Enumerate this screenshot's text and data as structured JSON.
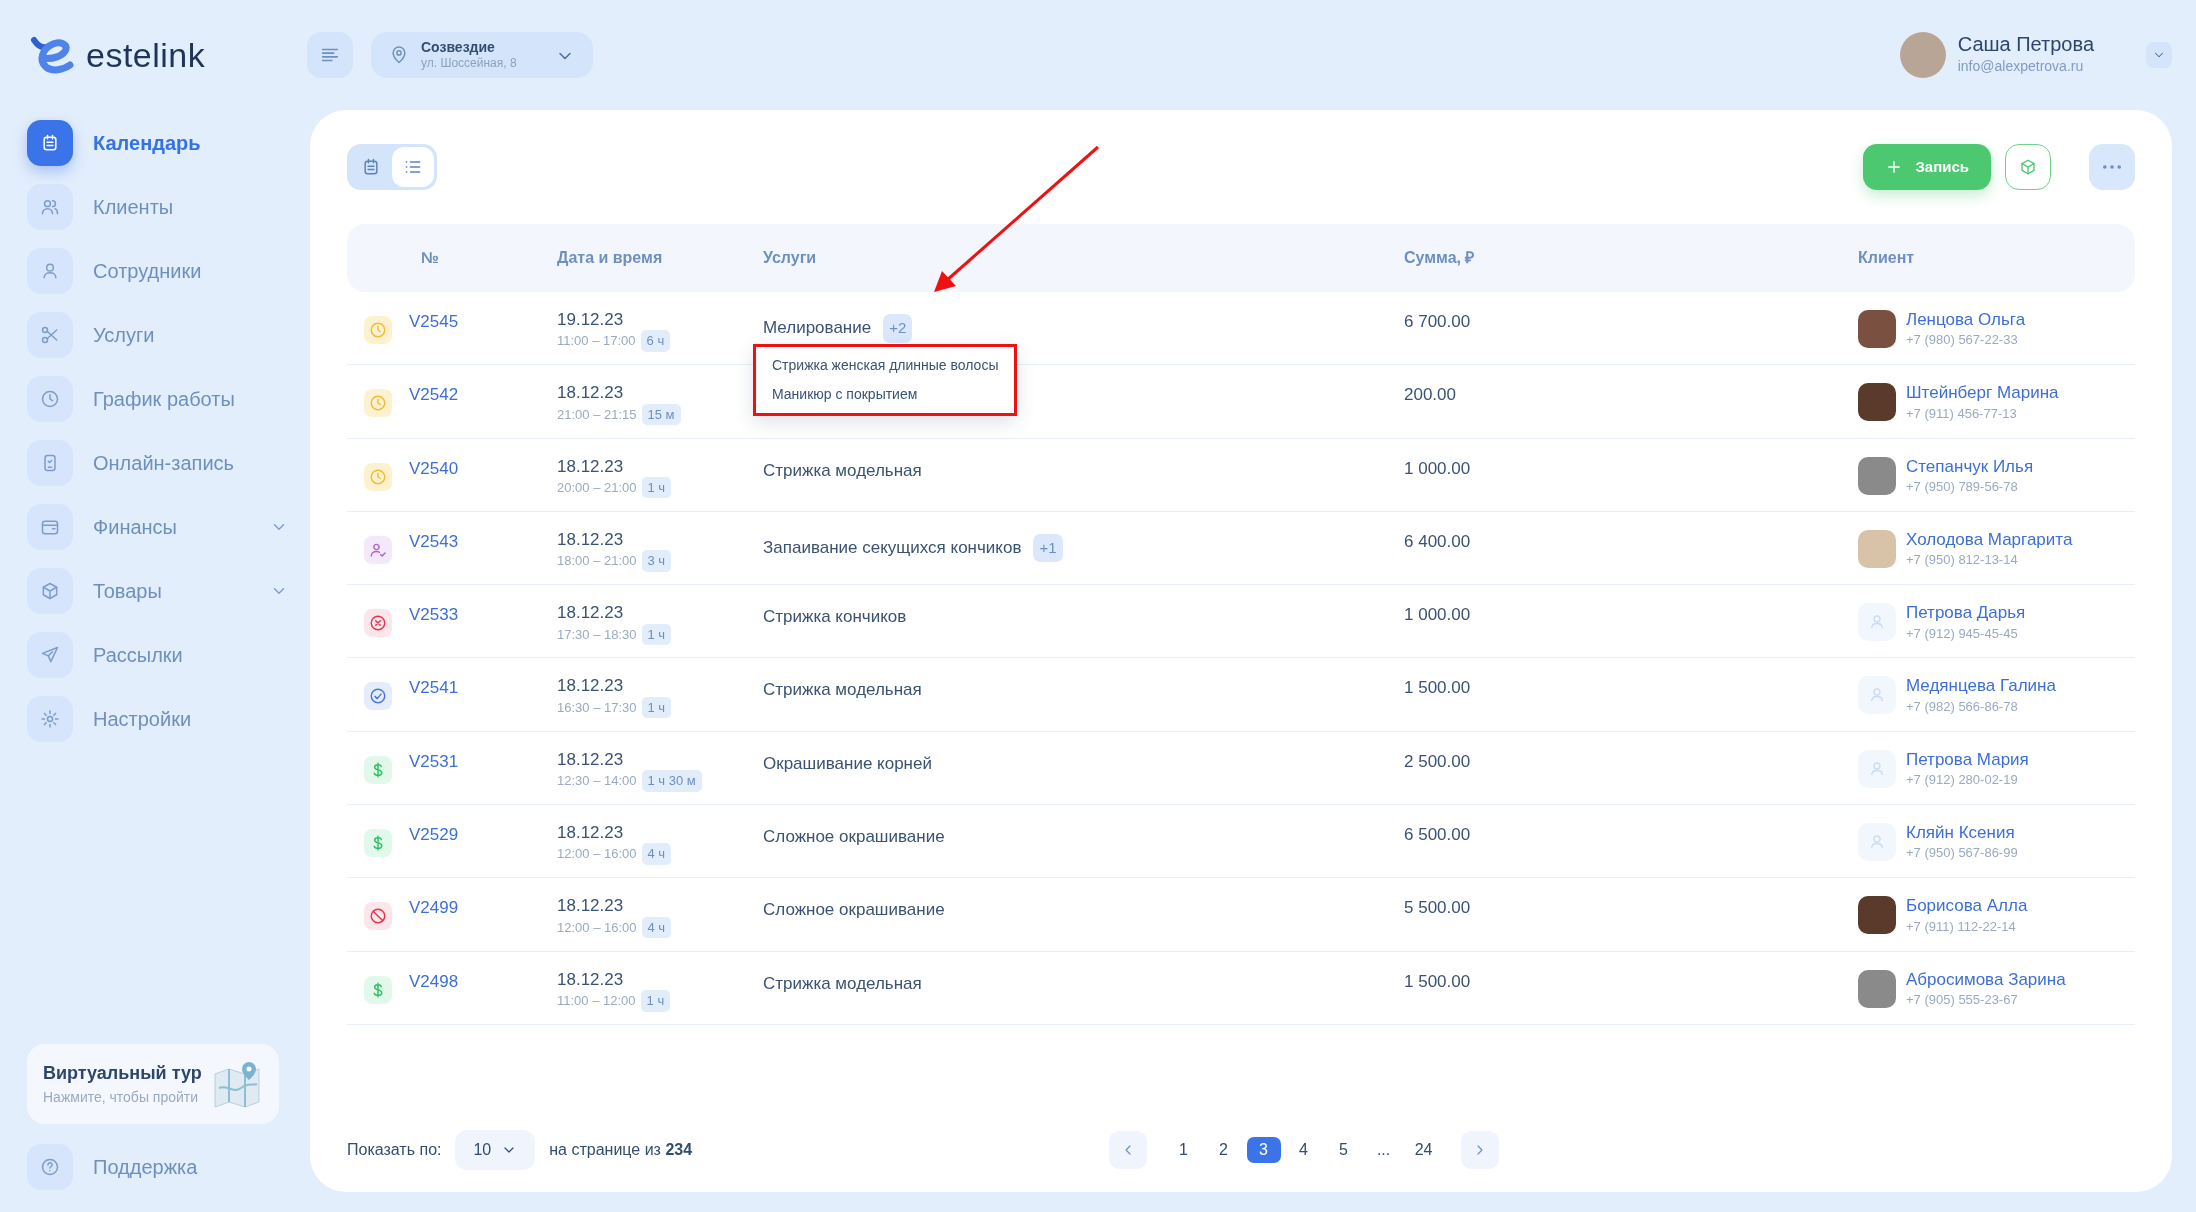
{
  "logo": {
    "text": "estelink"
  },
  "location": {
    "name": "Созвездие",
    "address": "ул. Шоссейная, 8"
  },
  "user": {
    "name": "Саша Петрова",
    "email": "info@alexpetrova.ru"
  },
  "sidebar": {
    "items": [
      {
        "label": "Календарь",
        "selected": true
      },
      {
        "label": "Клиенты",
        "selected": false
      },
      {
        "label": "Сотрудники",
        "selected": false
      },
      {
        "label": "Услуги",
        "selected": false
      },
      {
        "label": "График работы",
        "selected": false
      },
      {
        "label": "Онлайн-запись",
        "selected": false
      },
      {
        "label": "Финансы",
        "selected": false,
        "expanded": false
      },
      {
        "label": "Товары",
        "selected": false,
        "expanded": false
      },
      {
        "label": "Рассылки",
        "selected": false
      },
      {
        "label": "Настройки",
        "selected": false
      }
    ],
    "tour": {
      "title": "Виртуальный тур",
      "subtitle": "Нажмите, чтобы пройти"
    },
    "support": "Поддержка"
  },
  "view_toggle": [
    {
      "kind": "calendar",
      "selected": false
    },
    {
      "kind": "list",
      "selected": true
    }
  ],
  "add_button": "Запись",
  "table": {
    "columns": [
      "№",
      "Дата и время",
      "Услуги",
      "Сумма, ₽",
      "Клиент"
    ],
    "rows": [
      {
        "kind": "pending",
        "number": "V2545",
        "date": "19.12.23",
        "time": "11:00 – 17:00",
        "duration": "6 ч",
        "service": "Мелирование",
        "extra": "+2",
        "popup": [
          "Стрижка женская длинные волосы",
          "Маникюр с покрытием"
        ],
        "sum": "6 700.00",
        "client": "Ленцова Ольга",
        "phone": "+7 (980) 567-22-33",
        "photo": true
      },
      {
        "kind": "pending",
        "number": "V2542",
        "date": "18.12.23",
        "time": "21:00 – 21:15",
        "duration": "15 м",
        "sum": "200.00",
        "client": "Штейнберг Марина",
        "phone": "+7 (911) 456-77-13",
        "photo": true
      },
      {
        "kind": "pending",
        "number": "V2540",
        "date": "18.12.23",
        "time": "20:00 – 21:00",
        "duration": "1 ч",
        "service": "Стрижка модельная",
        "sum": "1 000.00",
        "client": "Степанчук Илья",
        "phone": "+7 (950) 789-56-78",
        "photo": true
      },
      {
        "kind": "confirmed",
        "number": "V2543",
        "date": "18.12.23",
        "time": "18:00 – 21:00",
        "duration": "3 ч",
        "service": "Запаивание секущихся кончиков",
        "extra": "+1",
        "sum": "6 400.00",
        "client": "Холодова Маргарита",
        "phone": "+7 (950) 812-13-14",
        "photo": true
      },
      {
        "kind": "cancelled",
        "number": "V2533",
        "date": "18.12.23",
        "time": "17:30 – 18:30",
        "duration": "1 ч",
        "service": "Стрижка кончиков",
        "sum": "1 000.00",
        "client": "Петрова Дарья",
        "phone": "+7 (912) 945-45-45",
        "photo": false
      },
      {
        "kind": "done",
        "number": "V2541",
        "date": "18.12.23",
        "time": "16:30 – 17:30",
        "duration": "1 ч",
        "service": "Стрижка модельная",
        "sum": "1 500.00",
        "client": "Медянцева Галина",
        "phone": "+7 (982) 566-86-78",
        "photo": false
      },
      {
        "kind": "paid",
        "number": "V2531",
        "date": "18.12.23",
        "time": "12:30 – 14:00",
        "duration": "1 ч 30 м",
        "service": "Окрашивание корней",
        "sum": "2 500.00",
        "client": "Петрова Мария",
        "phone": "+7 (912) 280-02-19",
        "photo": false
      },
      {
        "kind": "paid",
        "number": "V2529",
        "date": "18.12.23",
        "time": "12:00 – 16:00",
        "duration": "4 ч",
        "service": "Сложное окрашивание",
        "sum": "6 500.00",
        "client": "Кляйн Ксения",
        "phone": "+7 (950) 567-86-99",
        "photo": false
      },
      {
        "kind": "noshow",
        "number": "V2499",
        "date": "18.12.23",
        "time": "12:00 – 16:00",
        "duration": "4 ч",
        "service": "Сложное окрашивание",
        "sum": "5 500.00",
        "client": "Борисова Алла",
        "phone": "+7 (911) 112-22-14",
        "photo": true
      },
      {
        "kind": "paid",
        "number": "V2498",
        "date": "18.12.23",
        "time": "11:00 – 12:00",
        "duration": "1 ч",
        "service": "Стрижка модельная",
        "sum": "1 500.00",
        "client": "Абросимова Зарина",
        "phone": "+7 (905) 555-23-67",
        "photo": true
      }
    ]
  },
  "footer": {
    "show_label": "Показать по:",
    "page_size": "10",
    "total_text": "на странице из **234**"
  },
  "pagination": [
    {
      "label": "1",
      "selected": false
    },
    {
      "label": "2",
      "selected": false
    },
    {
      "label": "3",
      "selected": true
    },
    {
      "label": "4",
      "selected": false
    },
    {
      "label": "5",
      "selected": false
    },
    {
      "label": "...",
      "selected": false
    },
    {
      "label": "24",
      "selected": false
    }
  ]
}
